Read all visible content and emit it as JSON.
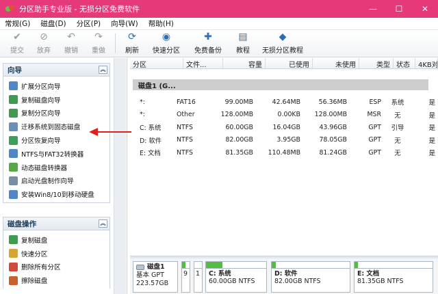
{
  "window": {
    "title": "分区助手专业版 - 无损分区免费软件",
    "controls": {
      "minimize": "—",
      "maximize": "☐",
      "close": "✕"
    }
  },
  "menu": [
    {
      "label": "常规(G)",
      "name": "menu-general"
    },
    {
      "label": "磁盘(D)",
      "name": "menu-disk"
    },
    {
      "label": "分区(P)",
      "name": "menu-partition"
    },
    {
      "label": "向导(W)",
      "name": "menu-wizard"
    },
    {
      "label": "帮助(H)",
      "name": "menu-help"
    }
  ],
  "toolbar": [
    {
      "label": "提交",
      "icon": "check-icon",
      "glyph": "✔",
      "disabled": true,
      "width": 38
    },
    {
      "label": "放弃",
      "icon": "discard-icon",
      "glyph": "⊘",
      "disabled": true,
      "width": 40
    },
    {
      "label": "撤销",
      "icon": "undo-icon",
      "glyph": "↶",
      "disabled": true,
      "width": 40
    },
    {
      "label": "重做",
      "icon": "redo-icon",
      "glyph": "↷",
      "disabled": true,
      "width": 40
    },
    {
      "sep": true
    },
    {
      "label": "刷新",
      "icon": "refresh-icon",
      "glyph": "⟳",
      "disabled": false,
      "width": 40
    },
    {
      "label": "快速分区",
      "icon": "quick-partition-icon",
      "glyph": "◉",
      "disabled": false,
      "width": 60
    },
    {
      "label": "免费备份",
      "icon": "backup-icon",
      "glyph": "✚",
      "disabled": false,
      "width": 62
    },
    {
      "label": "教程",
      "icon": "tutorial-icon",
      "glyph": "▤",
      "disabled": false,
      "width": 40
    },
    {
      "label": "无损分区教程",
      "icon": "lossless-tutorial-icon",
      "glyph": "◆",
      "disabled": false,
      "width": 76
    }
  ],
  "wizard": {
    "title": "向导",
    "items": [
      {
        "label": "扩展分区向导",
        "color": "#4f87c9"
      },
      {
        "label": "复制磁盘向导",
        "color": "#3f9b4f"
      },
      {
        "label": "复制分区向导",
        "color": "#3f9b4f"
      },
      {
        "label": "迁移系统到固态磁盘",
        "color": "#6a8fb8"
      },
      {
        "label": "分区恢复向导",
        "color": "#3aa05a"
      },
      {
        "label": "NTFS与FAT32转换器",
        "color": "#4f87c9"
      },
      {
        "label": "动态磁盘转换器",
        "color": "#5aa64a"
      },
      {
        "label": "启动光盘制作向导",
        "color": "#7a8fa5"
      },
      {
        "label": "安装Win8/10到移动硬盘",
        "color": "#4f87c9"
      }
    ]
  },
  "disk_ops": {
    "title": "磁盘操作",
    "items": [
      {
        "label": "复制磁盘",
        "color": "#3f9b4f"
      },
      {
        "label": "快速分区",
        "color": "#d9a532"
      },
      {
        "label": "删除所有分区",
        "color": "#d24a3a"
      },
      {
        "label": "擦除磁盘",
        "color": "#c9602e"
      }
    ]
  },
  "table": {
    "headers": [
      "分区",
      "文件...",
      "容量",
      "已使用",
      "未使用",
      "类型",
      "状态",
      "4KB对齐"
    ],
    "disk_label": "磁盘1 (G...",
    "rows": [
      {
        "partition": "*:",
        "fs": "FAT16",
        "capacity": "99.00MB",
        "used": "42.64MB",
        "free": "56.36MB",
        "type": "ESP",
        "status": "系统",
        "align": "是"
      },
      {
        "partition": "*:",
        "fs": "Other",
        "capacity": "128.00MB",
        "used": "0.00KB",
        "free": "128.00MB",
        "type": "MSR",
        "status": "无",
        "align": "是"
      },
      {
        "partition": "C: 系统",
        "fs": "NTFS",
        "capacity": "60.00GB",
        "used": "16.04GB",
        "free": "43.96GB",
        "type": "GPT",
        "status": "引导",
        "align": "是"
      },
      {
        "partition": "D: 软件",
        "fs": "NTFS",
        "capacity": "82.00GB",
        "used": "3.95GB",
        "free": "78.05GB",
        "type": "GPT",
        "status": "无",
        "align": "是"
      },
      {
        "partition": "E: 文档",
        "fs": "NTFS",
        "capacity": "81.35GB",
        "used": "110.48MB",
        "free": "81.24GB",
        "type": "GPT",
        "status": "无",
        "align": "是"
      }
    ]
  },
  "diskmap": {
    "disk": {
      "name": "磁盘1",
      "style": "基本 GPT",
      "size": "223.57GB"
    },
    "small_parts": [
      {
        "label": "9",
        "fill": 0.43
      },
      {
        "label": "1",
        "fill": 0.0
      }
    ],
    "parts": [
      {
        "name": "C: 系统",
        "detail": "60.00GB NTFS",
        "fill": 0.27
      },
      {
        "name": "D: 软件",
        "detail": "82.00GB NTFS",
        "fill": 0.05
      },
      {
        "name": "E: 文档",
        "detail": "81.35GB NTFS",
        "fill": 0.01
      }
    ]
  },
  "colors": {
    "titlebar": "#e6397a",
    "used_fill": "#55bb44",
    "annotation_arrow": "#e02020"
  }
}
